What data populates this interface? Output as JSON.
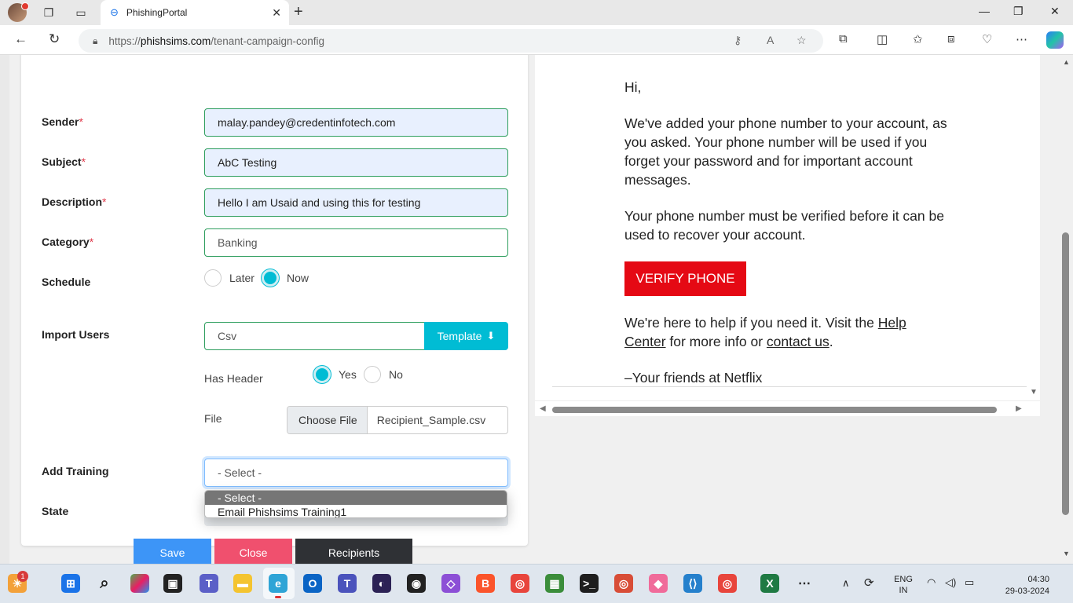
{
  "browser": {
    "tab_title": "PhishingPortal",
    "url_prefix": "https://",
    "url_host": "phishsims.com",
    "url_path": "/tenant-campaign-config"
  },
  "form": {
    "sender_label": "Sender",
    "sender_value": "malay.pandey@credentinfotech.com",
    "subject_label": "Subject",
    "subject_value": "AbC Testing",
    "description_label": "Description",
    "description_value": "Hello I am Usaid and using this for testing",
    "category_label": "Category",
    "category_value": "Banking",
    "schedule_label": "Schedule",
    "schedule_options": [
      {
        "label": "Later",
        "selected": false
      },
      {
        "label": "Now",
        "selected": true
      }
    ],
    "import_users_label": "Import Users",
    "import_users_value": "Csv",
    "template_button": "Template",
    "has_header_label": "Has Header",
    "has_header_options": [
      {
        "label": "Yes",
        "selected": true
      },
      {
        "label": "No",
        "selected": false
      }
    ],
    "file_label": "File",
    "choose_file_button": "Choose File",
    "file_name": "Recipient_Sample.csv",
    "add_training_label": "Add Training",
    "add_training_value": "- Select -",
    "training_options": [
      "- Select -",
      "Email Phishsims Training1"
    ],
    "state_label": "State",
    "required_marker": "*",
    "save_button": "Save",
    "close_button": "Close",
    "recipients_button": "Recipients"
  },
  "preview": {
    "greeting": "Hi,",
    "paragraph1": "We've added your phone number to your account, as you asked. Your phone number will be used if you forget your password and for important account messages.",
    "paragraph2": "Your phone number must be verified before it can be used to recover your account.",
    "verify_button": "VERIFY PHONE",
    "help_prefix": "We're here to help if you need it. Visit the ",
    "help_link": "Help Center",
    "help_middle": " for more info or ",
    "contact_link": "contact us",
    "help_suffix": ".",
    "signoff": "–Your friends at Netflix"
  },
  "taskbar": {
    "weather_badge": "1",
    "language_line1": "ENG",
    "language_line2": "IN",
    "time": "04:30",
    "date": "29-03-2024"
  },
  "colors": {
    "accent_cyan": "#00bcd4",
    "save": "#3d95f7",
    "close": "#f0506e",
    "recipients": "#2f3135",
    "netflix_red": "#e50914",
    "field_border": "#2e9e5e"
  }
}
